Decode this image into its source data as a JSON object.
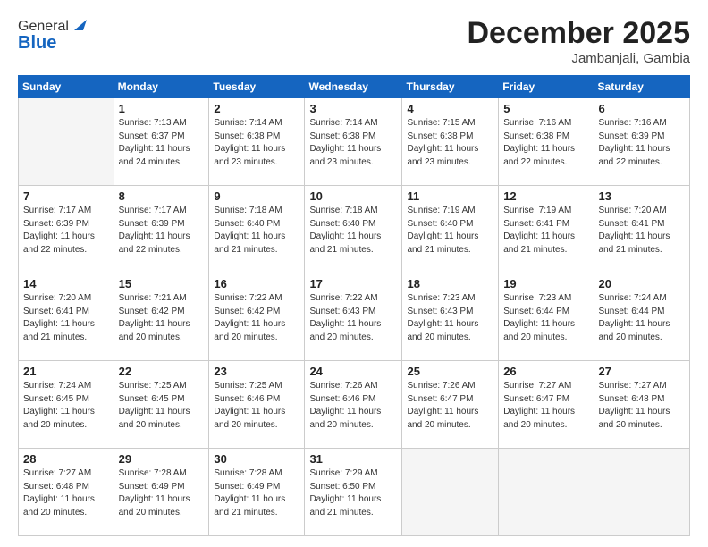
{
  "header": {
    "logo_general": "General",
    "logo_blue": "Blue",
    "month_year": "December 2025",
    "location": "Jambanjali, Gambia"
  },
  "weekdays": [
    "Sunday",
    "Monday",
    "Tuesday",
    "Wednesday",
    "Thursday",
    "Friday",
    "Saturday"
  ],
  "weeks": [
    [
      {
        "day": "",
        "sunrise": "",
        "sunset": "",
        "daylight": ""
      },
      {
        "day": "1",
        "sunrise": "Sunrise: 7:13 AM",
        "sunset": "Sunset: 6:37 PM",
        "daylight": "Daylight: 11 hours and 24 minutes."
      },
      {
        "day": "2",
        "sunrise": "Sunrise: 7:14 AM",
        "sunset": "Sunset: 6:38 PM",
        "daylight": "Daylight: 11 hours and 23 minutes."
      },
      {
        "day": "3",
        "sunrise": "Sunrise: 7:14 AM",
        "sunset": "Sunset: 6:38 PM",
        "daylight": "Daylight: 11 hours and 23 minutes."
      },
      {
        "day": "4",
        "sunrise": "Sunrise: 7:15 AM",
        "sunset": "Sunset: 6:38 PM",
        "daylight": "Daylight: 11 hours and 23 minutes."
      },
      {
        "day": "5",
        "sunrise": "Sunrise: 7:16 AM",
        "sunset": "Sunset: 6:38 PM",
        "daylight": "Daylight: 11 hours and 22 minutes."
      },
      {
        "day": "6",
        "sunrise": "Sunrise: 7:16 AM",
        "sunset": "Sunset: 6:39 PM",
        "daylight": "Daylight: 11 hours and 22 minutes."
      }
    ],
    [
      {
        "day": "7",
        "sunrise": "Sunrise: 7:17 AM",
        "sunset": "Sunset: 6:39 PM",
        "daylight": "Daylight: 11 hours and 22 minutes."
      },
      {
        "day": "8",
        "sunrise": "Sunrise: 7:17 AM",
        "sunset": "Sunset: 6:39 PM",
        "daylight": "Daylight: 11 hours and 22 minutes."
      },
      {
        "day": "9",
        "sunrise": "Sunrise: 7:18 AM",
        "sunset": "Sunset: 6:40 PM",
        "daylight": "Daylight: 11 hours and 21 minutes."
      },
      {
        "day": "10",
        "sunrise": "Sunrise: 7:18 AM",
        "sunset": "Sunset: 6:40 PM",
        "daylight": "Daylight: 11 hours and 21 minutes."
      },
      {
        "day": "11",
        "sunrise": "Sunrise: 7:19 AM",
        "sunset": "Sunset: 6:40 PM",
        "daylight": "Daylight: 11 hours and 21 minutes."
      },
      {
        "day": "12",
        "sunrise": "Sunrise: 7:19 AM",
        "sunset": "Sunset: 6:41 PM",
        "daylight": "Daylight: 11 hours and 21 minutes."
      },
      {
        "day": "13",
        "sunrise": "Sunrise: 7:20 AM",
        "sunset": "Sunset: 6:41 PM",
        "daylight": "Daylight: 11 hours and 21 minutes."
      }
    ],
    [
      {
        "day": "14",
        "sunrise": "Sunrise: 7:20 AM",
        "sunset": "Sunset: 6:41 PM",
        "daylight": "Daylight: 11 hours and 21 minutes."
      },
      {
        "day": "15",
        "sunrise": "Sunrise: 7:21 AM",
        "sunset": "Sunset: 6:42 PM",
        "daylight": "Daylight: 11 hours and 20 minutes."
      },
      {
        "day": "16",
        "sunrise": "Sunrise: 7:22 AM",
        "sunset": "Sunset: 6:42 PM",
        "daylight": "Daylight: 11 hours and 20 minutes."
      },
      {
        "day": "17",
        "sunrise": "Sunrise: 7:22 AM",
        "sunset": "Sunset: 6:43 PM",
        "daylight": "Daylight: 11 hours and 20 minutes."
      },
      {
        "day": "18",
        "sunrise": "Sunrise: 7:23 AM",
        "sunset": "Sunset: 6:43 PM",
        "daylight": "Daylight: 11 hours and 20 minutes."
      },
      {
        "day": "19",
        "sunrise": "Sunrise: 7:23 AM",
        "sunset": "Sunset: 6:44 PM",
        "daylight": "Daylight: 11 hours and 20 minutes."
      },
      {
        "day": "20",
        "sunrise": "Sunrise: 7:24 AM",
        "sunset": "Sunset: 6:44 PM",
        "daylight": "Daylight: 11 hours and 20 minutes."
      }
    ],
    [
      {
        "day": "21",
        "sunrise": "Sunrise: 7:24 AM",
        "sunset": "Sunset: 6:45 PM",
        "daylight": "Daylight: 11 hours and 20 minutes."
      },
      {
        "day": "22",
        "sunrise": "Sunrise: 7:25 AM",
        "sunset": "Sunset: 6:45 PM",
        "daylight": "Daylight: 11 hours and 20 minutes."
      },
      {
        "day": "23",
        "sunrise": "Sunrise: 7:25 AM",
        "sunset": "Sunset: 6:46 PM",
        "daylight": "Daylight: 11 hours and 20 minutes."
      },
      {
        "day": "24",
        "sunrise": "Sunrise: 7:26 AM",
        "sunset": "Sunset: 6:46 PM",
        "daylight": "Daylight: 11 hours and 20 minutes."
      },
      {
        "day": "25",
        "sunrise": "Sunrise: 7:26 AM",
        "sunset": "Sunset: 6:47 PM",
        "daylight": "Daylight: 11 hours and 20 minutes."
      },
      {
        "day": "26",
        "sunrise": "Sunrise: 7:27 AM",
        "sunset": "Sunset: 6:47 PM",
        "daylight": "Daylight: 11 hours and 20 minutes."
      },
      {
        "day": "27",
        "sunrise": "Sunrise: 7:27 AM",
        "sunset": "Sunset: 6:48 PM",
        "daylight": "Daylight: 11 hours and 20 minutes."
      }
    ],
    [
      {
        "day": "28",
        "sunrise": "Sunrise: 7:27 AM",
        "sunset": "Sunset: 6:48 PM",
        "daylight": "Daylight: 11 hours and 20 minutes."
      },
      {
        "day": "29",
        "sunrise": "Sunrise: 7:28 AM",
        "sunset": "Sunset: 6:49 PM",
        "daylight": "Daylight: 11 hours and 20 minutes."
      },
      {
        "day": "30",
        "sunrise": "Sunrise: 7:28 AM",
        "sunset": "Sunset: 6:49 PM",
        "daylight": "Daylight: 11 hours and 21 minutes."
      },
      {
        "day": "31",
        "sunrise": "Sunrise: 7:29 AM",
        "sunset": "Sunset: 6:50 PM",
        "daylight": "Daylight: 11 hours and 21 minutes."
      },
      {
        "day": "",
        "sunrise": "",
        "sunset": "",
        "daylight": ""
      },
      {
        "day": "",
        "sunrise": "",
        "sunset": "",
        "daylight": ""
      },
      {
        "day": "",
        "sunrise": "",
        "sunset": "",
        "daylight": ""
      }
    ]
  ]
}
